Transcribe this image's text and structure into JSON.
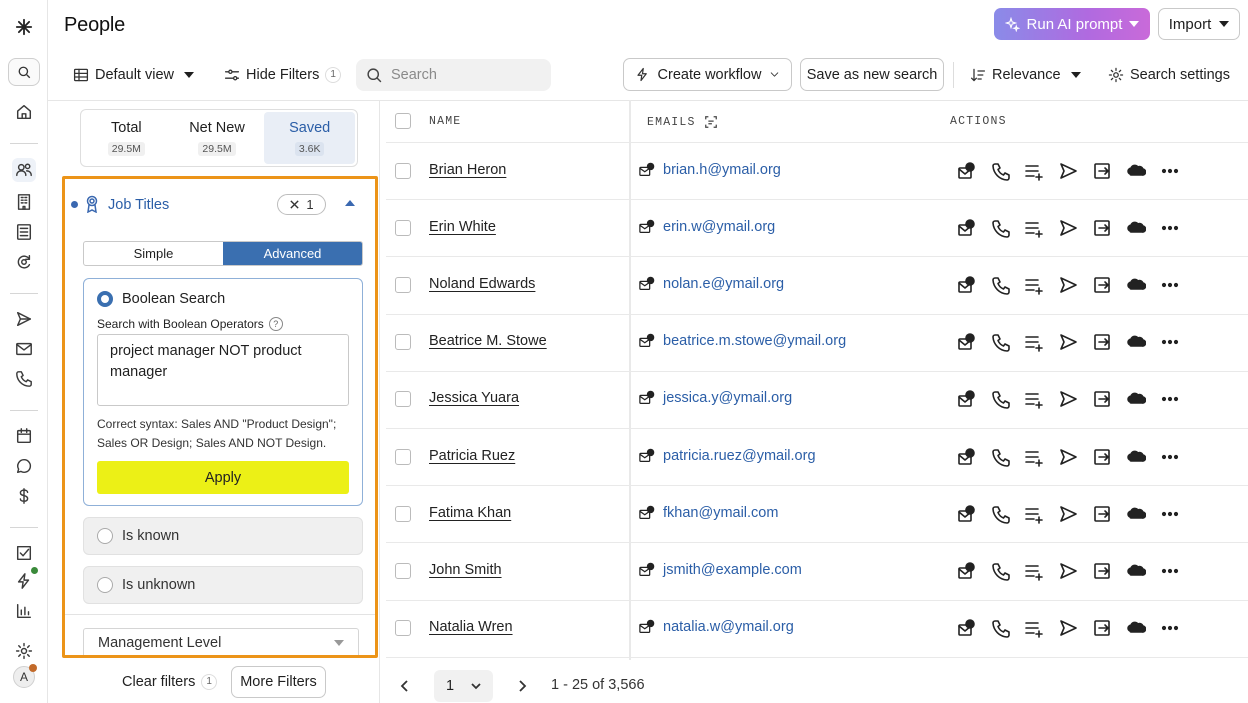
{
  "header": {
    "title": "People",
    "ai_button": "Run AI prompt",
    "import_button": "Import"
  },
  "toolbar": {
    "view_label": "Default view",
    "hide_filters_label": "Hide Filters",
    "hide_filters_count": "1",
    "search_placeholder": "Search",
    "create_workflow": "Create workflow",
    "save_search": "Save as new search",
    "sort_label": "Relevance",
    "settings_label": "Search settings"
  },
  "tabs": [
    {
      "label": "Total",
      "count": "29.5M"
    },
    {
      "label": "Net New",
      "count": "29.5M"
    },
    {
      "label": "Saved",
      "count": "3.6K"
    }
  ],
  "filter": {
    "title": "Job Titles",
    "chip_count": "1",
    "mode_simple": "Simple",
    "mode_advanced": "Advanced",
    "boolean_title": "Boolean Search",
    "boolean_sub": "Search with Boolean Operators",
    "boolean_value": "project manager NOT product manager",
    "help_text": "Correct syntax: Sales AND \"Product Design\"; Sales OR Design; Sales AND NOT Design.",
    "apply_label": "Apply",
    "is_known": "Is known",
    "is_unknown": "Is unknown",
    "management_level": "Management Level"
  },
  "footer": {
    "clear_filters": "Clear filters",
    "clear_count": "1",
    "more_filters": "More Filters"
  },
  "table": {
    "col_name": "NAME",
    "col_emails": "EMAILS",
    "col_actions": "ACTIONS",
    "rows": [
      {
        "name": "Brian Heron",
        "email": "brian.h@ymail.org"
      },
      {
        "name": "Erin White",
        "email": "erin.w@ymail.org"
      },
      {
        "name": "Noland Edwards",
        "email": "nolan.e@ymail.org"
      },
      {
        "name": "Beatrice M. Stowe",
        "email": "beatrice.m.stowe@ymail.org"
      },
      {
        "name": "Jessica Yuara",
        "email": "jessica.y@ymail.org"
      },
      {
        "name": "Patricia Ruez",
        "email": "patricia.ruez@ymail.org"
      },
      {
        "name": "Fatima Khan",
        "email": "fkhan@ymail.com"
      },
      {
        "name": "John Smith",
        "email": "jsmith@example.com"
      },
      {
        "name": "Natalia Wren",
        "email": "natalia.w@ymail.org"
      }
    ]
  },
  "pagination": {
    "page": "1",
    "range": "1 - 25 of 3,566"
  },
  "rail": {
    "avatar_initial": "A"
  },
  "colors": {
    "accent_blue": "#3a6fb0",
    "highlight_orange": "#ec9418",
    "apply_yellow": "#ecf016"
  }
}
